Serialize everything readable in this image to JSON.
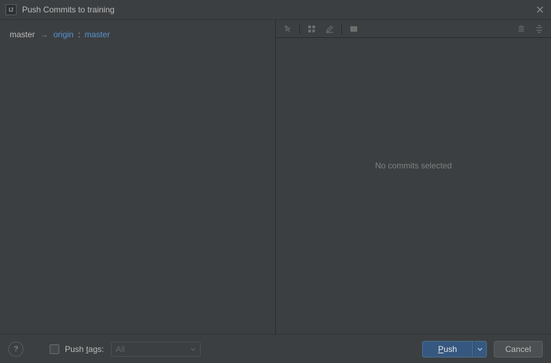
{
  "title": "Push Commits to training",
  "branch": {
    "local": "master",
    "remote": "origin",
    "remote_branch": "master"
  },
  "empty_message": "No commits selected",
  "footer": {
    "help": "?",
    "push_tags_label": "Push tags:",
    "push_tags_checked": false,
    "tag_scope": "All",
    "push_label": "Push",
    "cancel_label": "Cancel"
  }
}
